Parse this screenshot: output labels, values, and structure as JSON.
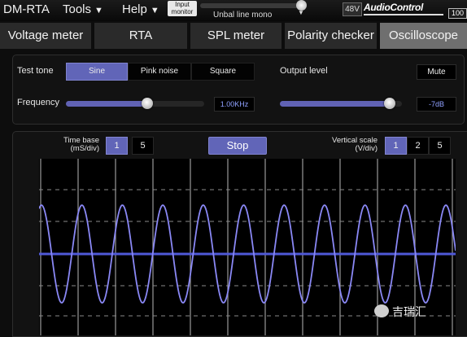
{
  "app": {
    "title": "DM-RTA"
  },
  "menu": [
    {
      "label": "Tools"
    },
    {
      "label": "Help"
    }
  ],
  "input_monitor": {
    "label_line1": "Input",
    "label_line2": "monitor"
  },
  "line_select": {
    "value": "Unbal line mono"
  },
  "phantom": {
    "label": "48V"
  },
  "brand": {
    "logo": "AudioControl"
  },
  "battery": {
    "level": "100"
  },
  "tabs": [
    {
      "label": "Voltage meter",
      "active": false
    },
    {
      "label": "RTA",
      "active": false
    },
    {
      "label": "SPL meter",
      "active": false
    },
    {
      "label": "Polarity checker",
      "active": false
    },
    {
      "label": "Oscilloscope",
      "active": true
    }
  ],
  "test_tone": {
    "label": "Test tone",
    "options": [
      "Sine",
      "Pink noise",
      "Square"
    ],
    "selected": "Sine"
  },
  "output_level": {
    "label": "Output level",
    "mute_label": "Mute",
    "value": "-7dB",
    "slider_fraction": 0.9
  },
  "frequency": {
    "label": "Frequency",
    "value": "1.00KHz",
    "slider_fraction": 0.59
  },
  "time_base": {
    "label_line1": "Time base",
    "label_line2": "(mS/div)",
    "options": [
      "1",
      "5"
    ],
    "selected": "1"
  },
  "stop_button": {
    "label": "Stop"
  },
  "vertical_scale": {
    "label_line1": "Vertical scale",
    "label_line2": "(V/div)",
    "options": [
      "1",
      "2",
      "5"
    ],
    "selected": "1"
  },
  "colors": {
    "accent": "#6165b8",
    "trace": "#8a88f5",
    "baseline": "#4f59d8",
    "value_text": "#8fa0ff"
  },
  "scope": {
    "cycles_visible": 10.3
  },
  "watermark": {
    "text": "吉瑞汇"
  }
}
